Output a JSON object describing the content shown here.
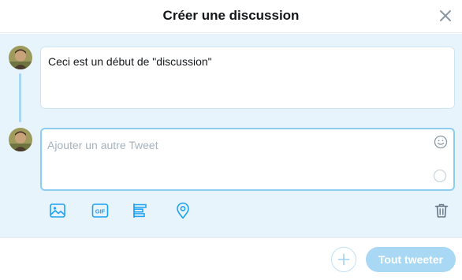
{
  "header": {
    "title": "Créer une discussion",
    "close_icon": "close-icon"
  },
  "thread": {
    "tweets": [
      {
        "text": "Ceci est un début de \"discussion\"",
        "avatar": "user-avatar"
      },
      {
        "value": "",
        "placeholder": "Ajouter un autre Tweet",
        "avatar": "user-avatar",
        "emoji_icon": "smiley-icon",
        "char_progress": 0
      }
    ]
  },
  "toolbar": {
    "icons": [
      "image-icon",
      "gif-icon",
      "poll-icon",
      "location-pin-icon",
      "trash-icon"
    ],
    "gif_label": "GIF"
  },
  "footer": {
    "add_icon": "plus-icon",
    "tweet_all_label": "Tout tweeter"
  },
  "colors": {
    "accent": "#1da1f2",
    "accent_light": "#a9d8f5",
    "thread_bg": "#e8f4fb",
    "border_focus": "#8ccdf1"
  }
}
